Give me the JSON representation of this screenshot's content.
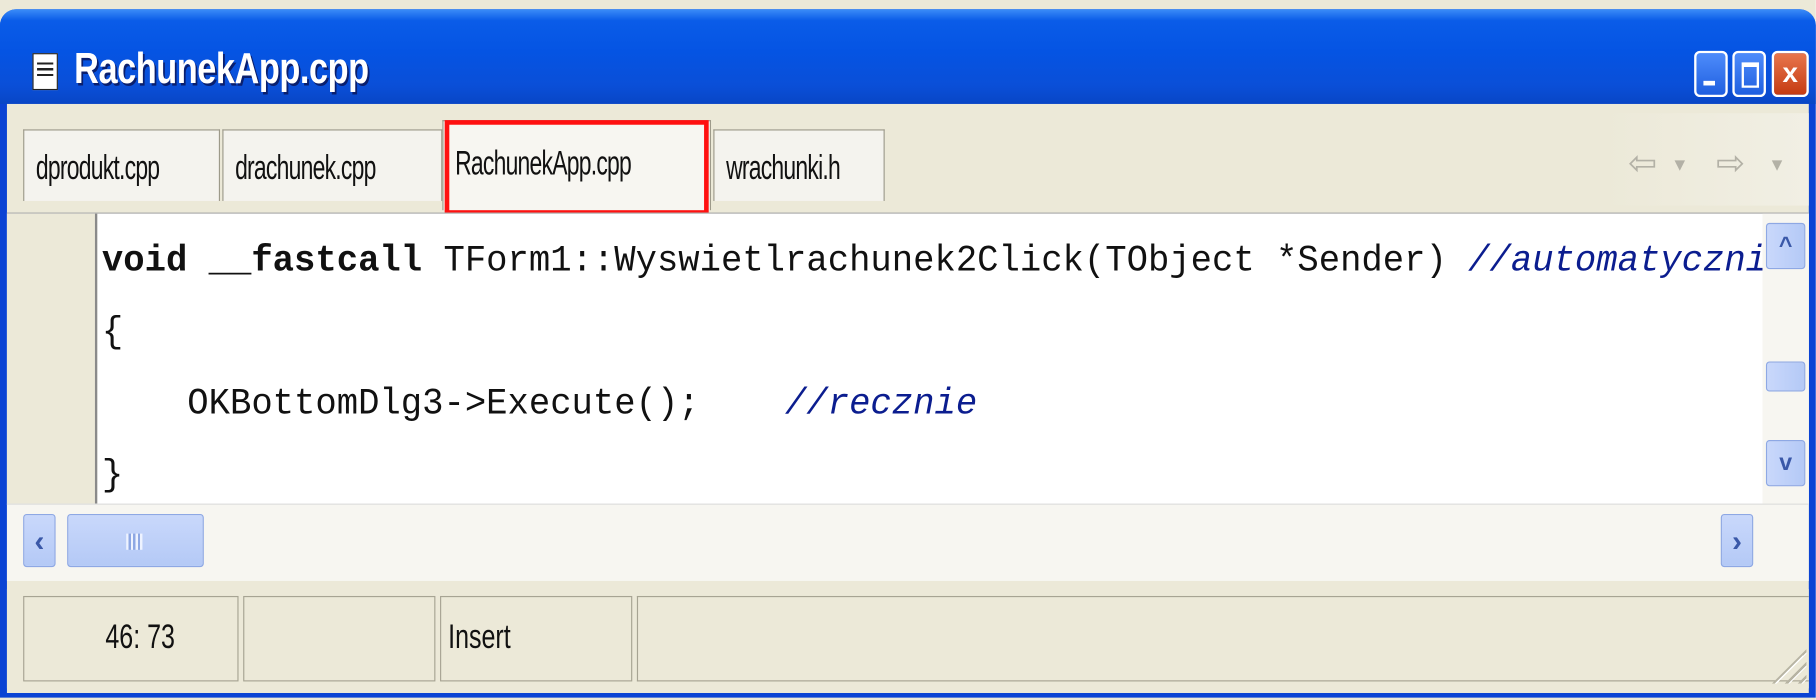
{
  "window": {
    "title": "RachunekApp.cpp",
    "icon": "document-icon"
  },
  "tabs": [
    {
      "label": "dprodukt.cpp",
      "active": false
    },
    {
      "label": "drachunek.cpp",
      "active": false
    },
    {
      "label": "RachunekApp.cpp",
      "active": true
    },
    {
      "label": "wrachunki.h",
      "active": false
    }
  ],
  "navigation": {
    "back_icon": "arrow-left-icon",
    "forward_icon": "arrow-right-icon"
  },
  "editor": {
    "line1": {
      "kw1": "void",
      "kw2": "__fastcall",
      "rest": " TForm1::Wyswietlrachunek2Click(TObject *Sender) ",
      "comment": "//automatycznie"
    },
    "line2": "{",
    "line3": {
      "code": "    OKBottomDlg3->Execute();    ",
      "comment": "//recznie"
    },
    "line4": "}"
  },
  "status_bar": {
    "position": "46: 73",
    "mode_blank": "",
    "insert_mode": "Insert",
    "message": ""
  },
  "colors": {
    "titlebar": "#0554e3",
    "active_tab_highlight": "#ff1010",
    "comment": "#0b1d8f"
  }
}
